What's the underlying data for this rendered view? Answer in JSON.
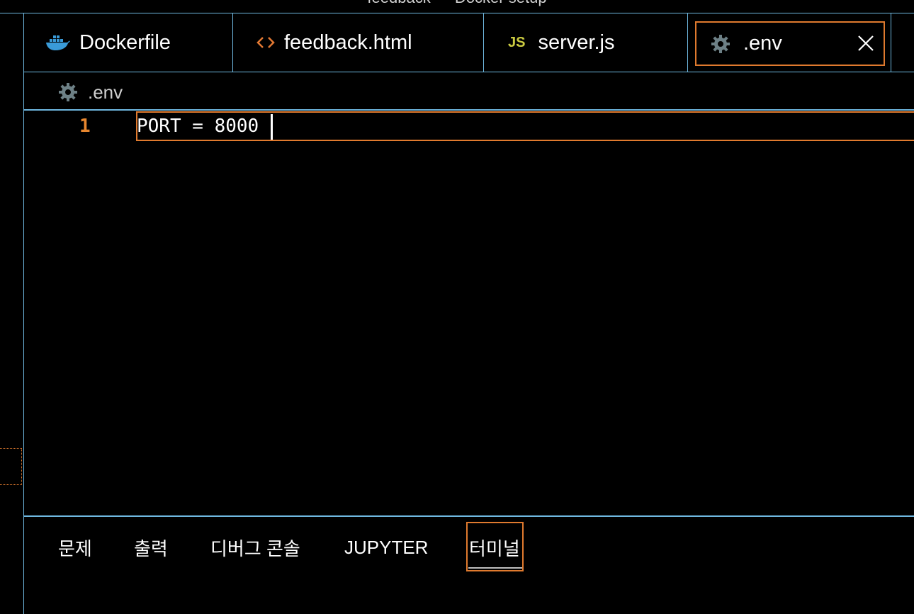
{
  "window": {
    "title": "feedback — Docker setup"
  },
  "tabs": [
    {
      "label": "Dockerfile",
      "icon": "docker-icon"
    },
    {
      "label": "feedback.html",
      "icon": "html-code-icon"
    },
    {
      "label": "server.js",
      "icon": "js-icon",
      "icon_text": "JS"
    },
    {
      "label": ".env",
      "icon": "gear-icon",
      "active": true
    }
  ],
  "breadcrumb": {
    "file": ".env",
    "icon": "gear-icon"
  },
  "editor": {
    "lines": [
      {
        "number": "1",
        "text": "PORT = 8000"
      }
    ]
  },
  "panel": {
    "tabs": [
      {
        "label": "문제"
      },
      {
        "label": "출력"
      },
      {
        "label": "디버그 콘솔"
      },
      {
        "label": "JUPYTER"
      },
      {
        "label": "터미널",
        "active": true
      }
    ]
  },
  "colors": {
    "background": "#000000",
    "border": "#6fb8e0",
    "focus": "#e07a2e",
    "line_number": "#e8872f",
    "docker_blue": "#3a9bd8",
    "html_orange": "#e37933",
    "js_yellow": "#cbcb41",
    "gear_gray": "#6d8086"
  }
}
